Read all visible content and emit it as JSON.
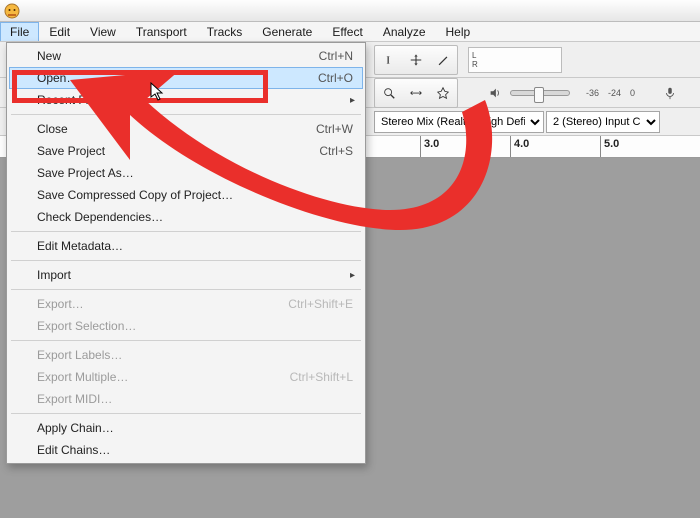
{
  "menubar": {
    "items": [
      "File",
      "Edit",
      "View",
      "Transport",
      "Tracks",
      "Generate",
      "Effect",
      "Analyze",
      "Help"
    ],
    "active_index": 0
  },
  "file_menu": {
    "items": [
      {
        "label": "New",
        "shortcut": "Ctrl+N",
        "enabled": true
      },
      {
        "label": "Open…",
        "shortcut": "Ctrl+O",
        "enabled": true,
        "highlight": true
      },
      {
        "label": "Recent Files",
        "submenu": true,
        "enabled": true
      },
      {
        "sep": true
      },
      {
        "label": "Close",
        "shortcut": "Ctrl+W",
        "enabled": true
      },
      {
        "label": "Save Project",
        "shortcut": "Ctrl+S",
        "enabled": true
      },
      {
        "label": "Save Project As…",
        "enabled": true
      },
      {
        "label": "Save Compressed Copy of Project…",
        "enabled": true
      },
      {
        "label": "Check Dependencies…",
        "enabled": true
      },
      {
        "sep": true
      },
      {
        "label": "Edit Metadata…",
        "enabled": true
      },
      {
        "sep": true
      },
      {
        "label": "Import",
        "submenu": true,
        "enabled": true
      },
      {
        "sep": true
      },
      {
        "label": "Export…",
        "shortcut": "Ctrl+Shift+E",
        "enabled": false
      },
      {
        "label": "Export Selection…",
        "enabled": false
      },
      {
        "sep": true
      },
      {
        "label": "Export Labels…",
        "enabled": false
      },
      {
        "label": "Export Multiple…",
        "shortcut": "Ctrl+Shift+L",
        "enabled": false
      },
      {
        "label": "Export MIDI…",
        "enabled": false
      },
      {
        "sep": true
      },
      {
        "label": "Apply Chain…",
        "enabled": true
      },
      {
        "label": "Edit Chains…",
        "enabled": true
      }
    ]
  },
  "meter": {
    "left": "L",
    "right": "R"
  },
  "db_ticks": [
    "-36",
    "-24",
    "0"
  ],
  "device": {
    "input_device": "Stereo Mix (Realtek High Definit",
    "input_channels": "2 (Stereo) Input C"
  },
  "ruler": {
    "ticks": [
      "3.0",
      "4.0",
      "5.0"
    ]
  }
}
